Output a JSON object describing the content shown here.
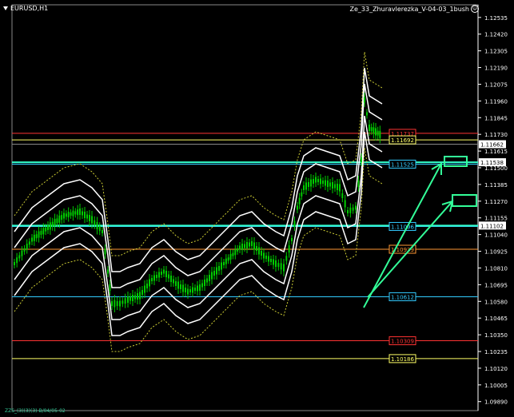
{
  "window": {
    "symbol_label": "EURUSD,H1",
    "indicator_label": "Ze_33_Zhuravlerezka_V-04-03_1bush",
    "bottom_label": "ZZS_(3)(3)(3)-B/04/05-02"
  },
  "colors": {
    "background": "#000000",
    "candle": "#00cc00",
    "band": "#ffffff",
    "axis": "#ffffff",
    "arrow": "#33ff99"
  },
  "chart_data": {
    "type": "candlestick",
    "y_axis_labels": [
      "1.12535",
      "1.12420",
      "1.12305",
      "1.12190",
      "1.12075",
      "1.11960",
      "1.11845",
      "1.11730",
      "1.11615",
      "1.11500",
      "1.11385",
      "1.11270",
      "1.11155",
      "1.11040",
      "1.10925",
      "1.10810",
      "1.10695",
      "1.10580",
      "1.10465",
      "1.10350",
      "1.10235",
      "1.10120",
      "1.10005",
      "1.09890"
    ],
    "ylim": [
      1.0985,
      1.126
    ],
    "current_price": "1.11662",
    "levels": [
      {
        "label": "1.11737",
        "value": 1.11737,
        "color": "#ff3333"
      },
      {
        "label": "1.11692",
        "value": 1.11692,
        "color": "#ffff66"
      },
      {
        "label": "1.11525",
        "value": 1.11525,
        "color": "#33ccff"
      },
      {
        "label": "1.11096",
        "value": 1.11096,
        "color": "#33ccff"
      },
      {
        "label": "1.10939",
        "value": 1.10939,
        "color": "#ff9933"
      },
      {
        "label": "1.10612",
        "value": 1.10612,
        "color": "#33ccff"
      },
      {
        "label": "1.10309",
        "value": 1.10309,
        "color": "#ff3333"
      },
      {
        "label": "1.10186",
        "value": 1.10186,
        "color": "#ffff66"
      }
    ],
    "highlight_levels": [
      {
        "label": "1.11538",
        "value": 1.11538
      },
      {
        "label": "1.11102",
        "value": 1.11102
      }
    ]
  }
}
